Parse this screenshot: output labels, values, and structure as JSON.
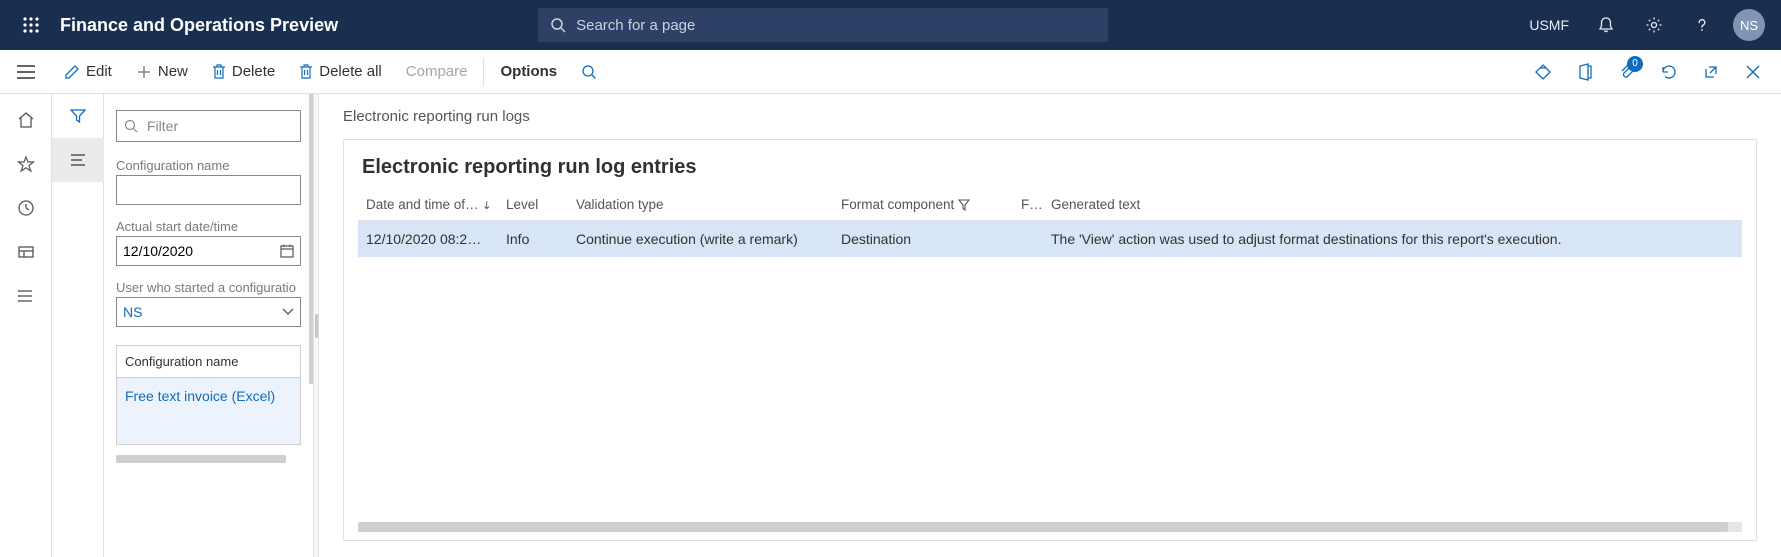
{
  "header": {
    "app_title": "Finance and Operations Preview",
    "search_placeholder": "Search for a page",
    "company": "USMF",
    "avatar_initials": "NS"
  },
  "action_bar": {
    "edit": "Edit",
    "new": "New",
    "delete": "Delete",
    "delete_all": "Delete all",
    "compare": "Compare",
    "options": "Options",
    "attachment_badge": "0"
  },
  "sidebar": {
    "filter_placeholder": "Filter",
    "labels": {
      "config_name": "Configuration name",
      "start_datetime": "Actual start date/time",
      "user_started": "User who started a configuratio"
    },
    "values": {
      "config_name": "",
      "start_datetime": "12/10/2020",
      "user_started": "NS"
    },
    "list": {
      "header": "Configuration name",
      "row0": "Free text invoice (Excel)"
    }
  },
  "main": {
    "breadcrumb": "Electronic reporting run logs",
    "panel_title": "Electronic reporting run log entries",
    "columns": {
      "datetime": "Date and time of…",
      "level": "Level",
      "validation_type": "Validation type",
      "format_component": "Format component",
      "f": "F…",
      "generated_text": "Generated text"
    },
    "rows": [
      {
        "datetime": "12/10/2020 08:2…",
        "level": "Info",
        "validation_type": "Continue execution (write a remark)",
        "format_component": "Destination",
        "f": "",
        "generated_text": "The 'View' action was used to adjust format destinations for this report's execution."
      }
    ]
  }
}
